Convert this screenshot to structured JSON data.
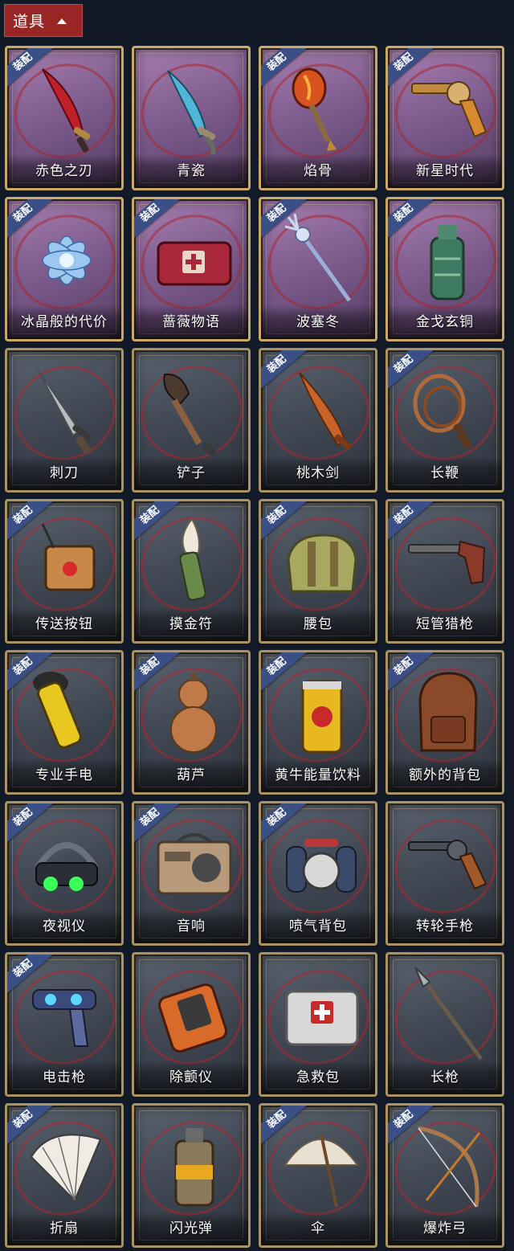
{
  "header": {
    "tab_label": "道具",
    "tab_icon": "chevron-up-icon"
  },
  "equip_badge": "装配",
  "colors": {
    "rare_card": "#8a6a9c",
    "common_card": "#4a525e",
    "badge": "#3a4f86",
    "tab": "#9b2626"
  },
  "items": [
    {
      "name": "赤色之刃",
      "rare": true,
      "equipped": true,
      "icon": "red-dagger-icon"
    },
    {
      "name": "青瓷",
      "rare": true,
      "equipped": false,
      "icon": "blue-dagger-icon"
    },
    {
      "name": "焰骨",
      "rare": true,
      "equipped": true,
      "icon": "flame-shovel-icon"
    },
    {
      "name": "新星时代",
      "rare": true,
      "equipped": true,
      "icon": "golden-revolver-icon"
    },
    {
      "name": "冰晶般的代价",
      "rare": true,
      "equipped": true,
      "icon": "ice-lotus-icon"
    },
    {
      "name": "蔷薇物语",
      "rare": true,
      "equipped": true,
      "icon": "rose-medkit-icon"
    },
    {
      "name": "波塞冬",
      "rare": true,
      "equipped": true,
      "icon": "trident-icon"
    },
    {
      "name": "金戈玄铜",
      "rare": true,
      "equipped": true,
      "icon": "bronze-grenade-icon"
    },
    {
      "name": "刺刀",
      "rare": false,
      "equipped": false,
      "icon": "bayonet-icon"
    },
    {
      "name": "铲子",
      "rare": false,
      "equipped": false,
      "icon": "shovel-icon"
    },
    {
      "name": "桃木剑",
      "rare": false,
      "equipped": true,
      "icon": "wooden-sword-icon"
    },
    {
      "name": "长鞭",
      "rare": false,
      "equipped": true,
      "icon": "whip-icon"
    },
    {
      "name": "传送按钮",
      "rare": false,
      "equipped": true,
      "icon": "teleport-button-icon"
    },
    {
      "name": "摸金符",
      "rare": false,
      "equipped": true,
      "icon": "tooth-charm-icon"
    },
    {
      "name": "腰包",
      "rare": false,
      "equipped": true,
      "icon": "waist-bag-icon"
    },
    {
      "name": "短管猎枪",
      "rare": false,
      "equipped": true,
      "icon": "shotgun-icon"
    },
    {
      "name": "专业手电",
      "rare": false,
      "equipped": true,
      "icon": "flashlight-icon"
    },
    {
      "name": "葫芦",
      "rare": false,
      "equipped": true,
      "icon": "gourd-icon"
    },
    {
      "name": "黄牛能量饮料",
      "rare": false,
      "equipped": true,
      "icon": "energy-drink-icon"
    },
    {
      "name": "额外的背包",
      "rare": false,
      "equipped": true,
      "icon": "backpack-icon"
    },
    {
      "name": "夜视仪",
      "rare": false,
      "equipped": true,
      "icon": "night-vision-icon"
    },
    {
      "name": "音响",
      "rare": false,
      "equipped": true,
      "icon": "radio-icon"
    },
    {
      "name": "喷气背包",
      "rare": false,
      "equipped": true,
      "icon": "jetpack-icon"
    },
    {
      "name": "转轮手枪",
      "rare": false,
      "equipped": false,
      "icon": "revolver-icon"
    },
    {
      "name": "电击枪",
      "rare": false,
      "equipped": true,
      "icon": "stun-gun-icon"
    },
    {
      "name": "除颤仪",
      "rare": false,
      "equipped": false,
      "icon": "defibrillator-icon"
    },
    {
      "name": "急救包",
      "rare": false,
      "equipped": false,
      "icon": "first-aid-kit-icon"
    },
    {
      "name": "长枪",
      "rare": false,
      "equipped": false,
      "icon": "spear-icon"
    },
    {
      "name": "折扇",
      "rare": false,
      "equipped": true,
      "icon": "folding-fan-icon"
    },
    {
      "name": "闪光弹",
      "rare": false,
      "equipped": false,
      "icon": "flashbang-icon"
    },
    {
      "name": "伞",
      "rare": false,
      "equipped": true,
      "icon": "umbrella-icon"
    },
    {
      "name": "爆炸弓",
      "rare": false,
      "equipped": true,
      "icon": "explosive-bow-icon"
    }
  ]
}
